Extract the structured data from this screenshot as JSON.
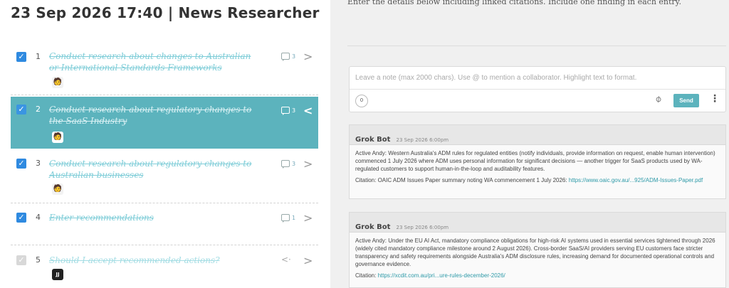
{
  "header": {
    "title": "23 Sep 2026 17:40 | News Researcher"
  },
  "tasks": [
    {
      "num": "1",
      "title": "Conduct research about changes to Australian or International Standards Frameworks",
      "count": "3",
      "avatar": "🧑"
    },
    {
      "num": "2",
      "title": "Conduct research about regulatory changes to the SaaS Industry",
      "count": "3",
      "avatar": "🧑"
    },
    {
      "num": "3",
      "title": "Conduct research about regulatory changes to Australian businesses",
      "count": "3",
      "avatar": "🧑"
    },
    {
      "num": "4",
      "title": "Enter recommendations",
      "count": "1",
      "avatar": "🧑"
    },
    {
      "num": "5",
      "title": "Should I accept recommended actions?",
      "avatar": "JJ"
    }
  ],
  "icons": {
    "check": "check-icon",
    "comment": "comment-icon",
    "chevron": "chevron-right-icon",
    "share": "share-icon",
    "clip": "paperclip-icon",
    "kebab": "kebab-menu-icon"
  },
  "colors": {
    "accent": "#5cb3bd",
    "checkbox": "#2f8ae0",
    "link": "#2e9aa8"
  },
  "main": {
    "instructions": "Enter the details below including linked citations. Include one finding in each entry.",
    "note": {
      "placeholder": "Leave a note (max 2000 chars). Use @ to mention a collaborator. Highlight text to format.",
      "char_count": "0",
      "send_label": "Send"
    },
    "comments": [
      {
        "author": "Grok Bot",
        "timestamp": "23 Sep 2026 6:00pm",
        "body": "Active Andy: Western Australia's ADM rules for regulated entities (notify individuals, provide information on request, enable human intervention) commenced 1 July 2026 where ADM uses personal information for significant decisions — another trigger for SaaS products used by WA-regulated customers to support human-in-the-loop and auditability features.",
        "citation_prefix": "Citation: OAIC ADM Issues Paper summary noting WA commencement 1 July 2026: ",
        "citation_link": "https://www.oaic.gov.au/...925/ADM-Issues-Paper.pdf"
      },
      {
        "author": "Grok Bot",
        "timestamp": "23 Sep 2026 6:00pm",
        "body": "Active Andy: Under the EU AI Act, mandatory compliance obligations for high-risk AI systems used in essential services tightened through 2026 (widely cited mandatory compliance milestone around 2 August 2026). Cross-border SaaS/AI providers serving EU customers face stricter transparency and safety requirements alongside Australia's ADM disclosure rules, increasing demand for documented operational controls and governance evidence.",
        "citation_prefix": "Citation: ",
        "citation_link": "https://xcdit.com.au/pri...ure-rules-december-2026/"
      }
    ]
  }
}
